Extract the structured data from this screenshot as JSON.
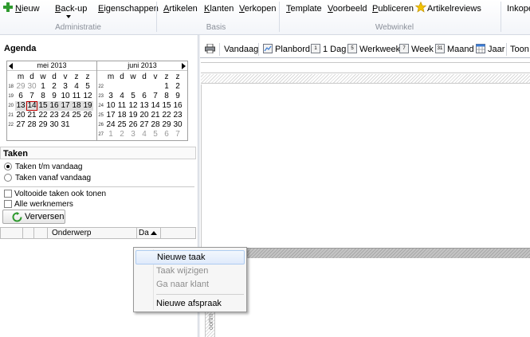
{
  "ribbon": {
    "items": [
      {
        "key": "nieuw",
        "label": "Nieuw"
      },
      {
        "key": "backup",
        "label": "Back-up"
      },
      {
        "key": "eigenschappen",
        "label": "Eigenschappen"
      },
      {
        "key": "artikelen",
        "label": "Artikelen"
      },
      {
        "key": "klanten",
        "label": "Klanten"
      },
      {
        "key": "verkopen",
        "label": "Verkopen"
      },
      {
        "key": "template",
        "label": "Template"
      },
      {
        "key": "voorbeeld",
        "label": "Voorbeeld"
      },
      {
        "key": "publiceren",
        "label": "Publiceren"
      },
      {
        "key": "artikelreviews",
        "label": "Artikelreviews"
      },
      {
        "key": "inkoop",
        "label": "Inkope"
      }
    ],
    "groups": [
      "Administratie",
      "Basis",
      "Webwinkel"
    ]
  },
  "agenda": {
    "title": "Agenda",
    "weekday_headers": [
      "m",
      "d",
      "w",
      "d",
      "v",
      "z",
      "z"
    ],
    "months": [
      {
        "name": "mei 2013",
        "weeks": [
          "18",
          "19",
          "20",
          "21",
          "22"
        ],
        "rows": [
          [
            "29",
            "30",
            "1",
            "2",
            "3",
            "4",
            "5"
          ],
          [
            "6",
            "7",
            "8",
            "9",
            "10",
            "11",
            "12"
          ],
          [
            "13",
            "14",
            "15",
            "16",
            "17",
            "18",
            "19"
          ],
          [
            "20",
            "21",
            "22",
            "23",
            "24",
            "25",
            "26"
          ],
          [
            "27",
            "28",
            "29",
            "30",
            "31",
            "",
            ""
          ]
        ]
      },
      {
        "name": "juni 2013",
        "weeks": [
          "22",
          "23",
          "24",
          "25",
          "26",
          "27"
        ],
        "rows": [
          [
            "",
            "",
            "",
            "",
            "",
            "1",
            "2"
          ],
          [
            "3",
            "4",
            "5",
            "6",
            "7",
            "8",
            "9"
          ],
          [
            "10",
            "11",
            "12",
            "13",
            "14",
            "15",
            "16"
          ],
          [
            "17",
            "18",
            "19",
            "20",
            "21",
            "22",
            "23"
          ],
          [
            "24",
            "25",
            "26",
            "27",
            "28",
            "29",
            "30"
          ],
          [
            "1",
            "2",
            "3",
            "4",
            "5",
            "6",
            "7"
          ]
        ]
      }
    ]
  },
  "taken": {
    "title": "Taken",
    "radio_options": [
      "Taken t/m vandaag",
      "Taken vanaf vandaag"
    ],
    "checkboxes": [
      "Voltooide taken ook tonen",
      "Alle werknemers"
    ],
    "refresh_label": "Verversen",
    "columns": [
      "Onderwerp",
      "Da"
    ]
  },
  "toolbar": {
    "buttons": [
      {
        "key": "vandaag",
        "label": "Vandaag"
      },
      {
        "key": "planbord",
        "label": "Planbord"
      },
      {
        "key": "dag",
        "label": "1 Dag",
        "icon_text": "1"
      },
      {
        "key": "werkweek",
        "label": "Werkweek",
        "icon_text": "5"
      },
      {
        "key": "week",
        "label": "Week",
        "icon_text": "7"
      },
      {
        "key": "maand",
        "label": "Maand",
        "icon_text": "31"
      },
      {
        "key": "jaar",
        "label": "Jaar"
      },
      {
        "key": "toon",
        "label": "Toon"
      }
    ]
  },
  "context_menu": {
    "items": [
      {
        "label": "Nieuwe taak",
        "enabled": true
      },
      {
        "label": "Taak wijzigen",
        "enabled": false
      },
      {
        "label": "Ga naar klant",
        "enabled": false
      },
      {
        "label": "Nieuwe afspraak",
        "enabled": true
      }
    ]
  },
  "side_vertical_text": "oortm",
  "colors": {
    "accent_green": "#2e9a2e",
    "today_border": "#c00000",
    "menu_hover": "#dfeafb"
  }
}
